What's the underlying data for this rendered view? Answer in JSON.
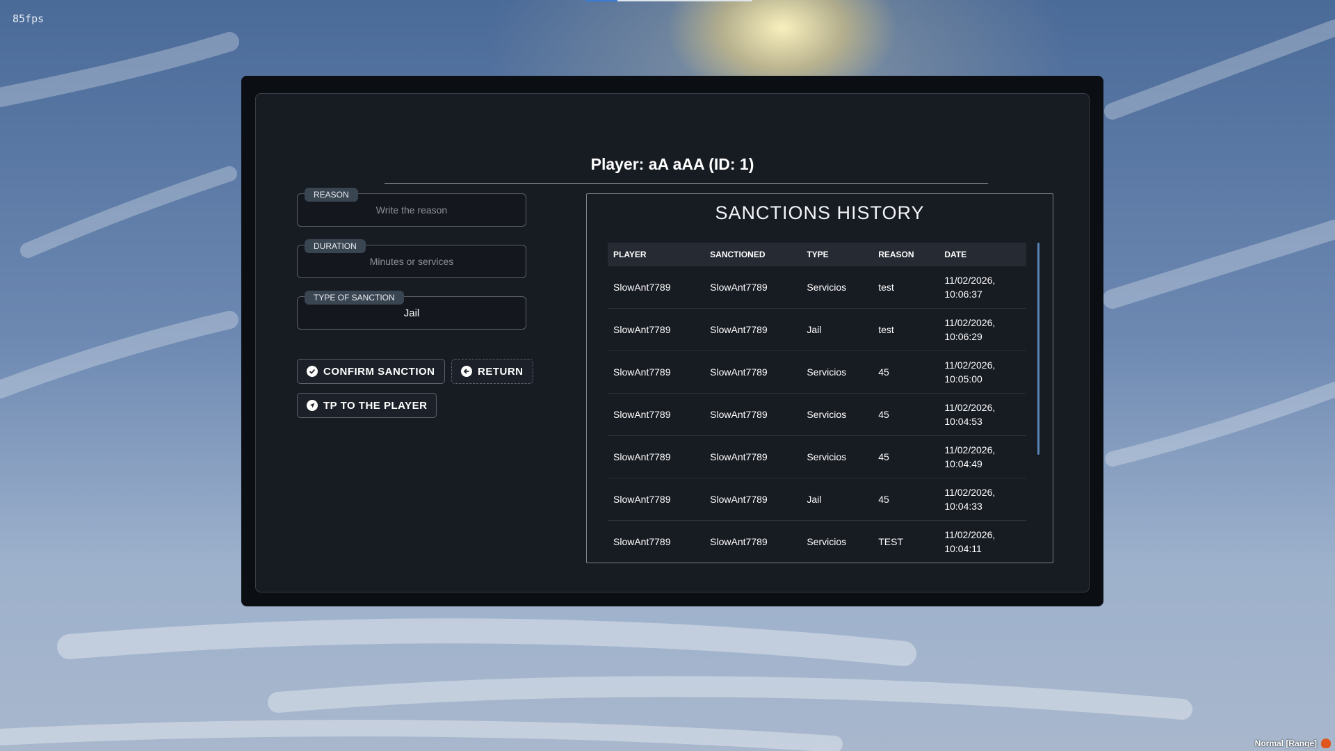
{
  "hud": {
    "fps": "85fps",
    "mode": "Normal [Range]"
  },
  "header": {
    "title": "Player: aA aAA (ID: 1)"
  },
  "form": {
    "reason": {
      "label": "REASON",
      "placeholder": "Write the reason",
      "value": ""
    },
    "duration": {
      "label": "DURATION",
      "placeholder": "Minutes or services",
      "value": ""
    },
    "type": {
      "label": "TYPE OF SANCTION",
      "value": "Jail"
    }
  },
  "buttons": {
    "confirm": "CONFIRM SANCTION",
    "return": "RETURN",
    "tp": "TP TO THE PLAYER"
  },
  "icons": {
    "confirm": "check-circle-icon",
    "return": "arrow-left-circle-icon",
    "tp": "navigation-arrow-icon"
  },
  "history": {
    "title": "SANCTIONS HISTORY",
    "columns": [
      "PLAYER",
      "SANCTIONED",
      "TYPE",
      "REASON",
      "DATE"
    ],
    "rows": [
      {
        "player": "SlowAnt7789",
        "sanctioned": "SlowAnt7789",
        "type": "Servicios",
        "reason": "test",
        "date1": "11/02/2026,",
        "date2": "10:06:37"
      },
      {
        "player": "SlowAnt7789",
        "sanctioned": "SlowAnt7789",
        "type": "Jail",
        "reason": "test",
        "date1": "11/02/2026,",
        "date2": "10:06:29"
      },
      {
        "player": "SlowAnt7789",
        "sanctioned": "SlowAnt7789",
        "type": "Servicios",
        "reason": "45",
        "date1": "11/02/2026,",
        "date2": "10:05:00"
      },
      {
        "player": "SlowAnt7789",
        "sanctioned": "SlowAnt7789",
        "type": "Servicios",
        "reason": "45",
        "date1": "11/02/2026,",
        "date2": "10:04:53"
      },
      {
        "player": "SlowAnt7789",
        "sanctioned": "SlowAnt7789",
        "type": "Servicios",
        "reason": "45",
        "date1": "11/02/2026,",
        "date2": "10:04:49"
      },
      {
        "player": "SlowAnt7789",
        "sanctioned": "SlowAnt7789",
        "type": "Jail",
        "reason": "45",
        "date1": "11/02/2026,",
        "date2": "10:04:33"
      },
      {
        "player": "SlowAnt7789",
        "sanctioned": "SlowAnt7789",
        "type": "Servicios",
        "reason": "TEST",
        "date1": "11/02/2026,",
        "date2": "10:04:11"
      }
    ]
  },
  "colors": {
    "panel_bg": "#171b22",
    "outer_bg": "#0b0e13",
    "tag_bg": "#3a4552",
    "scroll_accent": "#5a83b5"
  }
}
